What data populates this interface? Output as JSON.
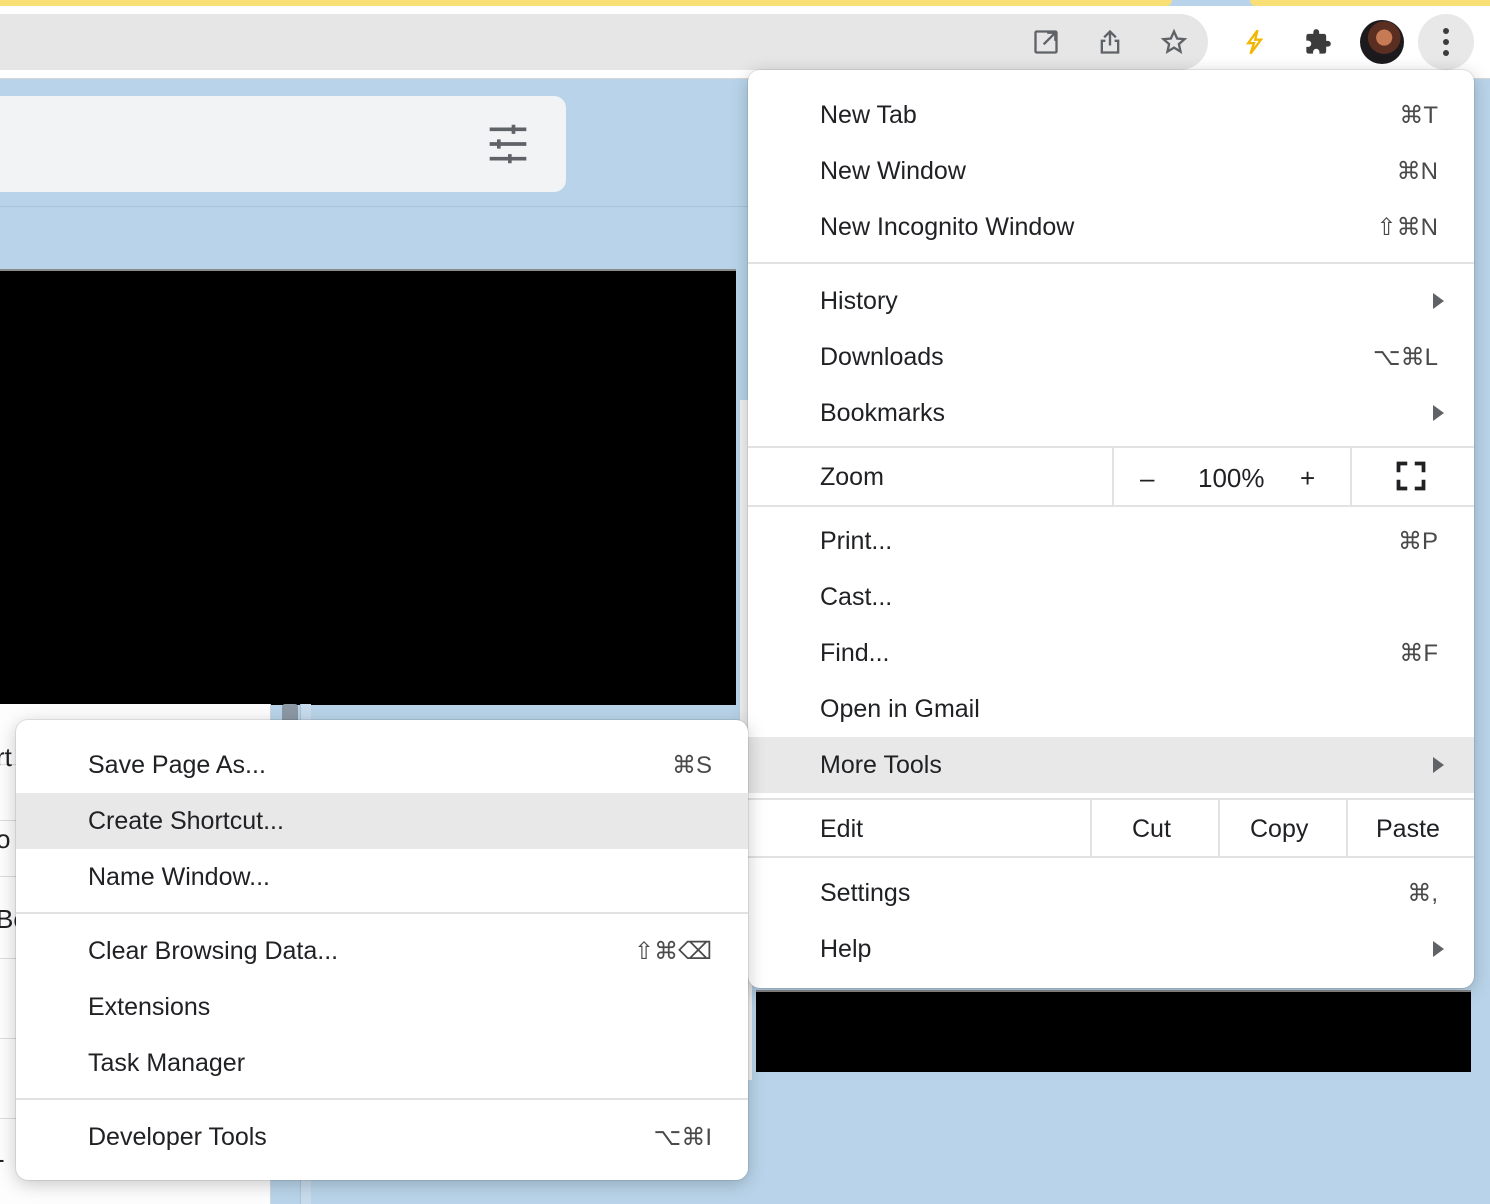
{
  "toolbar": {
    "icons": [
      "open-in-new-icon",
      "share-icon",
      "bookmark-star-icon",
      "lightning-extension-icon",
      "extensions-puzzle-icon",
      "profile-avatar",
      "more-menu-icon"
    ]
  },
  "main_menu": {
    "new_tab": {
      "label": "New Tab",
      "shortcut": "⌘T"
    },
    "new_window": {
      "label": "New Window",
      "shortcut": "⌘N"
    },
    "new_incognito": {
      "label": "New Incognito Window",
      "shortcut": "⇧⌘N"
    },
    "history": {
      "label": "History"
    },
    "downloads": {
      "label": "Downloads",
      "shortcut": "⌥⌘L"
    },
    "bookmarks": {
      "label": "Bookmarks"
    },
    "zoom": {
      "label": "Zoom",
      "minus": "–",
      "value": "100%",
      "plus": "+"
    },
    "print": {
      "label": "Print...",
      "shortcut": "⌘P"
    },
    "cast": {
      "label": "Cast..."
    },
    "find": {
      "label": "Find...",
      "shortcut": "⌘F"
    },
    "open_gmail": {
      "label": "Open in Gmail"
    },
    "more_tools": {
      "label": "More Tools"
    },
    "edit": {
      "label": "Edit",
      "cut": "Cut",
      "copy": "Copy",
      "paste": "Paste"
    },
    "settings": {
      "label": "Settings",
      "shortcut": "⌘,"
    },
    "help": {
      "label": "Help"
    }
  },
  "sub_menu": {
    "save_page": {
      "label": "Save Page As...",
      "shortcut": "⌘S"
    },
    "create_shortcut": {
      "label": "Create Shortcut..."
    },
    "name_window": {
      "label": "Name Window..."
    },
    "clear_data": {
      "label": "Clear Browsing Data...",
      "shortcut": "⇧⌘⌫"
    },
    "extensions": {
      "label": "Extensions"
    },
    "task_manager": {
      "label": "Task Manager"
    },
    "dev_tools": {
      "label": "Developer Tools",
      "shortcut": "⌥⌘I"
    }
  },
  "background": {
    "list_fragments": [
      "rt",
      "o",
      "Be",
      "-"
    ]
  }
}
